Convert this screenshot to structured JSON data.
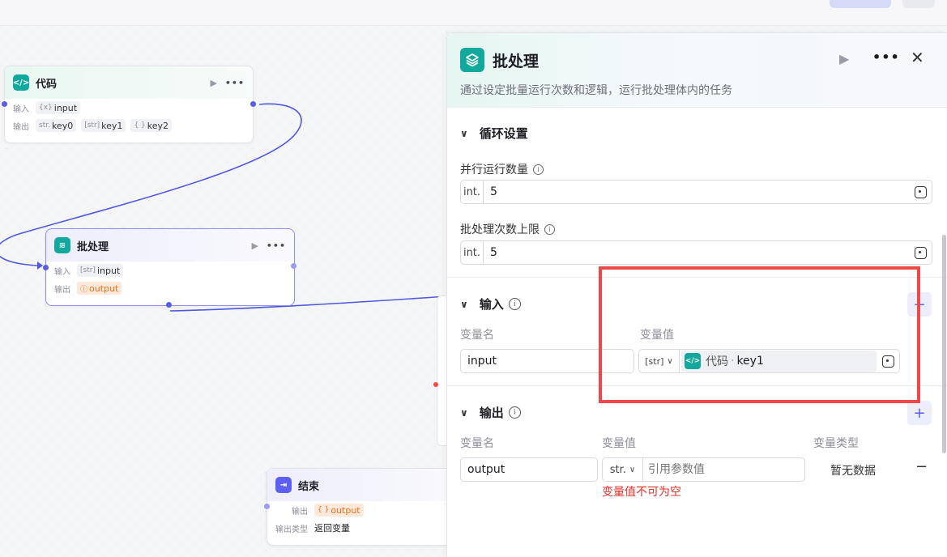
{
  "canvas": {
    "nodes": {
      "code": {
        "title": "代码",
        "input_label": "输入",
        "output_label": "输出",
        "inputs": [
          {
            "type": "{x}",
            "name": "input"
          }
        ],
        "outputs": [
          {
            "type": "str.",
            "name": "key0"
          },
          {
            "type": "[str]",
            "name": "key1"
          },
          {
            "type": "{ }",
            "name": "key2"
          }
        ]
      },
      "batch": {
        "title": "批处理",
        "input_label": "输入",
        "output_label": "输出",
        "inputs": [
          {
            "type": "[str]",
            "name": "input"
          }
        ],
        "outputs": [
          {
            "type": "ⓘ",
            "name": "output"
          }
        ]
      },
      "end": {
        "title": "结束",
        "output_label": "输出",
        "output_type_label": "输出类型",
        "outputs": [
          {
            "type": "{ }",
            "name": "output"
          }
        ],
        "output_type_value": "返回变量"
      }
    }
  },
  "panel": {
    "title": "批处理",
    "description": "通过设定批量运行次数和逻辑，运行批处理体内的任务",
    "loop_section": {
      "title": "循环设置",
      "parallel": {
        "label": "并行运行数量",
        "type": "int.",
        "value": "5"
      },
      "max_batch": {
        "label": "批处理次数上限",
        "type": "int.",
        "value": "5"
      }
    },
    "input_section": {
      "title": "输入",
      "col_name": "变量名",
      "col_value": "变量值",
      "row": {
        "name": "input",
        "type": "[str]",
        "ref_source": "代码",
        "ref_separator": "·",
        "ref_var": "key1"
      }
    },
    "output_section": {
      "title": "输出",
      "col_name": "变量名",
      "col_value": "变量值",
      "col_type": "变量类型",
      "row": {
        "name": "output",
        "type": "str.",
        "placeholder": "引用参数值",
        "type_value": "暂无数据"
      },
      "error": "变量值不可为空"
    }
  },
  "colors": {
    "accent": "#5a5de8",
    "teal": "#13a89e",
    "error": "#e0302a",
    "highlight": "#f0474a"
  }
}
